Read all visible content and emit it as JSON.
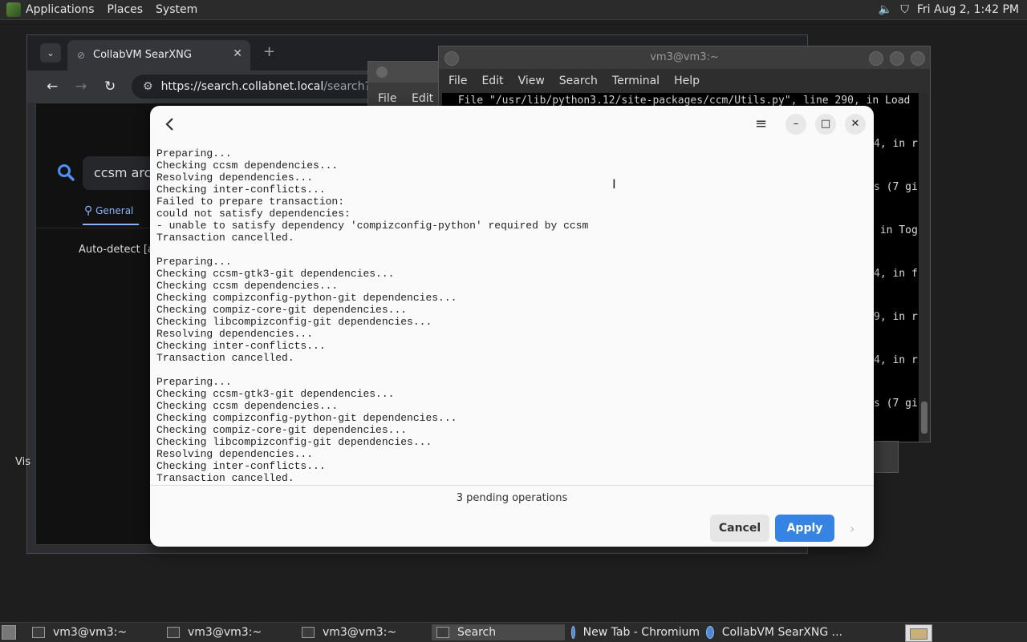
{
  "top_panel": {
    "menus": [
      "Applications",
      "Places",
      "System"
    ],
    "clock": "Fri Aug  2,  1:42 PM"
  },
  "browser": {
    "tab_title": "CollabVM SearXNG",
    "url_host": "https://search.collabnet.local",
    "url_path": "/search?q=cc",
    "search_query": "ccsm arch",
    "general_tab": "General",
    "autodetect": "Auto-detect [au",
    "side_text": "Vis"
  },
  "terminal_small": {
    "menus": [
      "File",
      "Edit"
    ]
  },
  "terminal": {
    "title": "vm3@vm3:~",
    "menus": [
      "File",
      "Edit",
      "View",
      "Search",
      "Terminal",
      "Help"
    ],
    "first_line": " File \"/usr/lib/python3.12/site-packages/ccm/Utils.py\", line 290, in Load",
    "right_fragments": [
      "4, in r",
      "s (7 gi",
      " in Tog",
      "4, in f",
      "9, in r",
      "4, in r",
      "s (7 gi"
    ]
  },
  "dialog": {
    "log_lines": [
      "Preparing...",
      "Checking ccsm dependencies...",
      "Resolving dependencies...",
      "Checking inter-conflicts...",
      "Failed to prepare transaction:",
      "could not satisfy dependencies:",
      "- unable to satisfy dependency 'compizconfig-python' required by ccsm",
      "Transaction cancelled.",
      "",
      "Preparing...",
      "Checking ccsm-gtk3-git dependencies...",
      "Checking ccsm dependencies...",
      "Checking compizconfig-python-git dependencies...",
      "Checking compiz-core-git dependencies...",
      "Checking libcompizconfig-git dependencies...",
      "Resolving dependencies...",
      "Checking inter-conflicts...",
      "Transaction cancelled.",
      "",
      "Preparing...",
      "Checking ccsm-gtk3-git dependencies...",
      "Checking ccsm dependencies...",
      "Checking compizconfig-python-git dependencies...",
      "Checking compiz-core-git dependencies...",
      "Checking libcompizconfig-git dependencies...",
      "Resolving dependencies...",
      "Checking inter-conflicts...",
      "Transaction cancelled."
    ],
    "pending": "3 pending operations",
    "cancel_label": "Cancel",
    "apply_label": "Apply"
  },
  "taskbar": {
    "items": [
      {
        "label": "vm3@vm3:~"
      },
      {
        "label": "vm3@vm3:~"
      },
      {
        "label": "vm3@vm3:~"
      },
      {
        "label": "Search"
      },
      {
        "label": "New Tab - Chromium"
      },
      {
        "label": "CollabVM SearXNG ..."
      }
    ]
  },
  "colors": {
    "accent": "#3584e4",
    "link": "#8ab4f8"
  }
}
